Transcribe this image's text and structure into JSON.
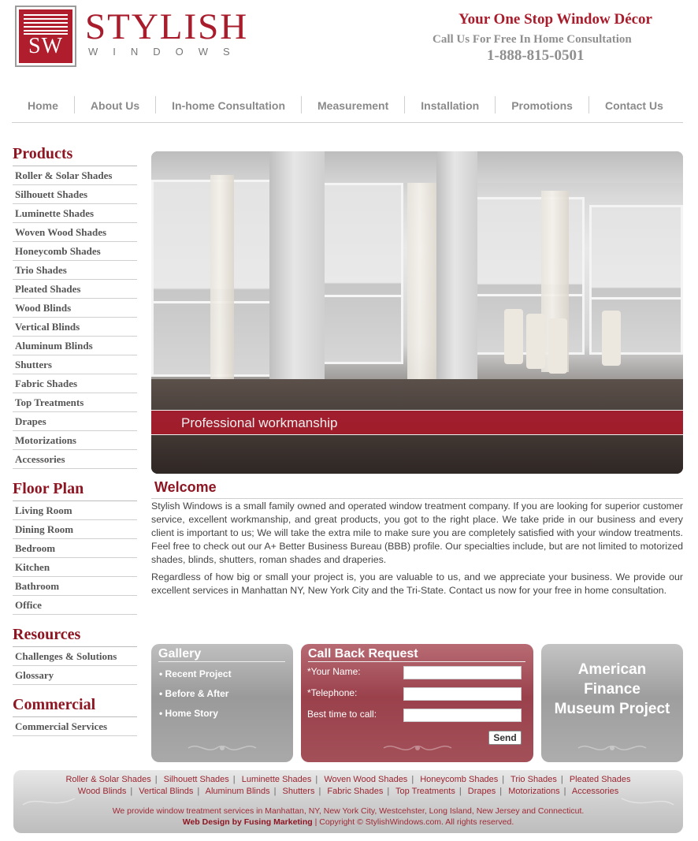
{
  "header": {
    "logo_letters": "SW",
    "brand_name": "STYLISH",
    "brand_sub": "WINDOWS",
    "tagline": "Your One Stop Window Décor",
    "consultation": "Call Us For Free In Home Consultation",
    "phone": "1-888-815-0501"
  },
  "nav": [
    "Home",
    "About Us",
    "In-home Consultation",
    "Measurement",
    "Installation",
    "Promotions",
    "Contact Us"
  ],
  "sidebar": {
    "products_heading": "Products",
    "products": [
      "Roller & Solar Shades",
      "Silhouett Shades",
      "Luminette Shades",
      "Woven Wood Shades",
      "Honeycomb Shades",
      "Trio Shades",
      "Pleated Shades",
      "Wood Blinds",
      "Vertical Blinds",
      "Aluminum Blinds",
      "Shutters",
      "Fabric Shades",
      "Top Treatments",
      "Drapes",
      "Motorizations",
      "Accessories"
    ],
    "floorplan_heading": "Floor Plan",
    "floorplan": [
      "Living Room",
      "Dining Room",
      "Bedroom",
      "Kitchen",
      "Bathroom",
      "Office"
    ],
    "resources_heading": "Resources",
    "resources": [
      "Challenges & Solutions",
      "Glossary"
    ],
    "commercial_heading": "Commercial",
    "commercial": [
      "Commercial Services"
    ]
  },
  "hero": {
    "caption": "Professional workmanship"
  },
  "welcome": {
    "title": "Welcome",
    "p1": "Stylish Windows is a small family owned and operated window treatment company. If you are looking for superior customer service, excellent workmanship, and great products, you got to the right place. We take pride in our business and every client is important to us; We will take the extra mile to make sure you are completely satisfied with your window treatments. Feel free to check out our A+ Better Business Bureau (BBB) profile. Our specialties include, but are not limited to motorized shades, blinds, shutters, roman shades and draperies.",
    "p2": "Regardless of how big or small your project is, you are valuable to us, and we appreciate your business. We provide our excellent services in Manhattan NY, New York City and the Tri-State. Contact us now for your free in home consultation."
  },
  "gallery": {
    "title": "Gallery",
    "items": [
      "• Recent Project",
      "• Before & After",
      "• Home Story"
    ]
  },
  "callback": {
    "title": "Call Back Request",
    "name_label": "*Your Name:",
    "phone_label": "*Telephone:",
    "time_label": "Best time to call:",
    "send_label": "Send"
  },
  "museum": {
    "line1": "American",
    "line2": "Finance",
    "line3": "Museum Project"
  },
  "footer": {
    "row1": [
      "Roller & Solar Shades",
      "Silhouett Shades",
      "Luminette Shades",
      "Woven Wood Shades",
      "Honeycomb Shades",
      "Trio Shades",
      "Pleated Shades"
    ],
    "row2": [
      "Wood Blinds",
      "Vertical Blinds",
      "Aluminum Blinds",
      "Shutters",
      "Fabric Shades",
      "Top Treatments",
      "Drapes",
      "Motorizations",
      "Accessories"
    ],
    "note": "We provide window treatment services in Manhattan, NY, New York City, Westcehster, Long Island, New Jersey and Connecticut.",
    "credit_prefix": "Web Design by",
    "credit_name": "Fusing Marketing",
    "copyright": "| Copyright © StylishWindows.com. All rights reserved."
  },
  "colors": {
    "brand_red": "#a81c2c",
    "heading_red": "#8e1522",
    "nav_gray": "#8a8a8a"
  }
}
